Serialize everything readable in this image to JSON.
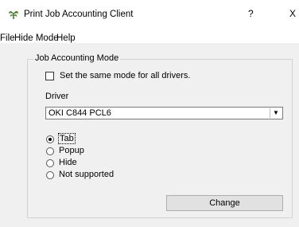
{
  "window": {
    "title": "Print Job Accounting Client",
    "help_glyph": "?",
    "close_glyph": "X"
  },
  "menu": [
    "File",
    "Hide Mode",
    "Help"
  ],
  "group": {
    "label": "Job Accounting Mode",
    "same_mode_checkbox": {
      "label": "Set the same mode for all drivers.",
      "checked": false
    },
    "driver_label": "Driver",
    "driver_value": "OKI C844 PCL6",
    "modes": [
      {
        "label": "Tab",
        "checked": true
      },
      {
        "label": "Popup",
        "checked": false
      },
      {
        "label": "Hide",
        "checked": false
      },
      {
        "label": "Not supported",
        "checked": false
      }
    ],
    "change_button": "Change"
  }
}
